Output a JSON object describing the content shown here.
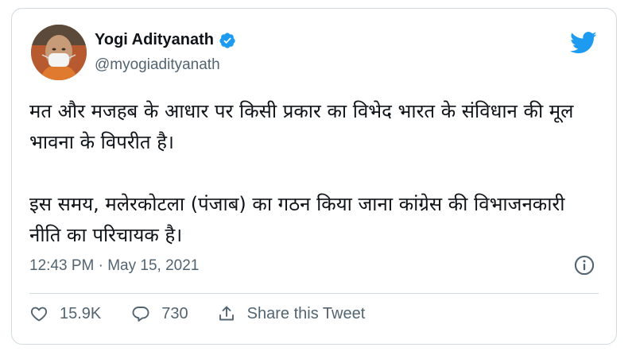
{
  "author": {
    "name": "Yogi Adityanath",
    "handle": "@myogiadityanath",
    "verified": true
  },
  "tweet": {
    "paragraph_1": "मत और मजहब के आधार पर किसी प्रकार का विभेद भारत के संविधान की मूल भावना के विपरीत है।",
    "paragraph_2": "इस समय, मलेरकोटला (पंजाब) का गठन किया जाना कांग्रेस की विभाजनकारी नीति का परिचायक है।",
    "timestamp": "12:43 PM · May 15, 2021"
  },
  "actions": {
    "likes": "15.9K",
    "replies": "730",
    "share_label": "Share this Tweet"
  },
  "colors": {
    "brand": "#1d9bf0",
    "text": "#0f1419",
    "secondary_text": "#536471",
    "border": "#cfd9de"
  },
  "icons": [
    "verified-badge-icon",
    "twitter-bird-icon",
    "info-icon",
    "heart-icon",
    "reply-icon",
    "share-icon"
  ]
}
